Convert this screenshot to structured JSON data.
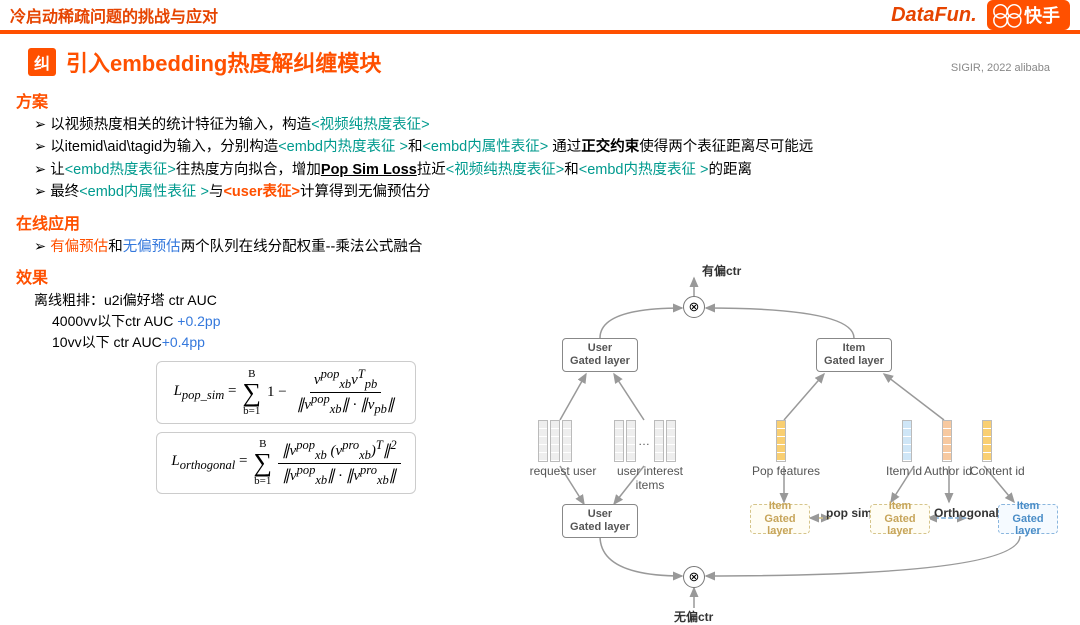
{
  "top": {
    "title": "冷启动稀疏问题的挑战与应对",
    "logo_datafun": "DataFun.",
    "logo_kuaishou": "快手"
  },
  "subtitle": {
    "badge": "纠",
    "text": "引入embedding热度解纠缠模块"
  },
  "citation": "SIGIR, 2022 alibaba",
  "scheme": {
    "heading": "方案",
    "b1_a": "以视频热度相关的统计特征为输入，构造",
    "b1_tag": "<视频纯热度表征>",
    "b2_a": "以itemid\\aid\\tagid为输入，分别构造",
    "b2_t1": "<embd内热度表征 >",
    "b2_b": "和",
    "b2_t2": "<embd内属性表征>",
    "b2_c": " 通过",
    "b2_bold": "正交约束",
    "b2_d": "使得两个表征距离尽可能远",
    "b3_a": "让",
    "b3_t1": "<embd热度表征>",
    "b3_b": "往热度方向拟合，增加",
    "b3_ul": "Pop Sim Loss",
    "b3_c": "拉近",
    "b3_t2": "<视频纯热度表征>",
    "b3_d": "和",
    "b3_t3": "<embd内热度表征 >",
    "b3_e": "的距离",
    "b4_a": "最终",
    "b4_t1": "<embd内属性表征 >",
    "b4_b": "与",
    "b4_t2": "<user表征>",
    "b4_c": "计算得到无偏预估分"
  },
  "online": {
    "heading": "在线应用",
    "b1_a": "有偏预估",
    "b1_b": "和",
    "b1_c": "无偏预估",
    "b1_d": "两个队列在线分配权重--乘法公式融合"
  },
  "effect": {
    "heading": "效果",
    "l1": "离线粗排：u2i偏好塔 ctr AUC",
    "l2a": "4000vv以下ctr AUC ",
    "l2b": "+0.2pp",
    "l3a": "10vv以下 ctr AUC",
    "l3b": "+0.4pp"
  },
  "formula": {
    "f1_lhs": "L",
    "f1_sub": "pop_sim",
    "f1_eq": " = ",
    "f1_top": "B",
    "f1_bot": "b=1",
    "f1_body": "1 − ",
    "f1_num": "v",
    "f1_den": "∥v",
    "f1_sup1": "pop",
    "f1_sub1": "xb",
    "f1_sup2": "T",
    "f1_sub2": "pb",
    "f2_lhs": "L",
    "f2_sub": "orthogonal",
    "f2_sup3": "pro",
    "f2_exp": "2"
  },
  "diagram": {
    "biased_label": "有偏ctr",
    "unbiased_label": "无偏ctr",
    "user_gated": "User\nGated layer",
    "item_gated": "Item\nGated layer",
    "req_user": "request user",
    "user_items": "user interest items",
    "pop_feat": "Pop features",
    "item_id": "Item id",
    "author_id": "Author id",
    "content_id": "Content id",
    "pop_sim": "pop sim",
    "orthogonal": "Orthogonal"
  }
}
